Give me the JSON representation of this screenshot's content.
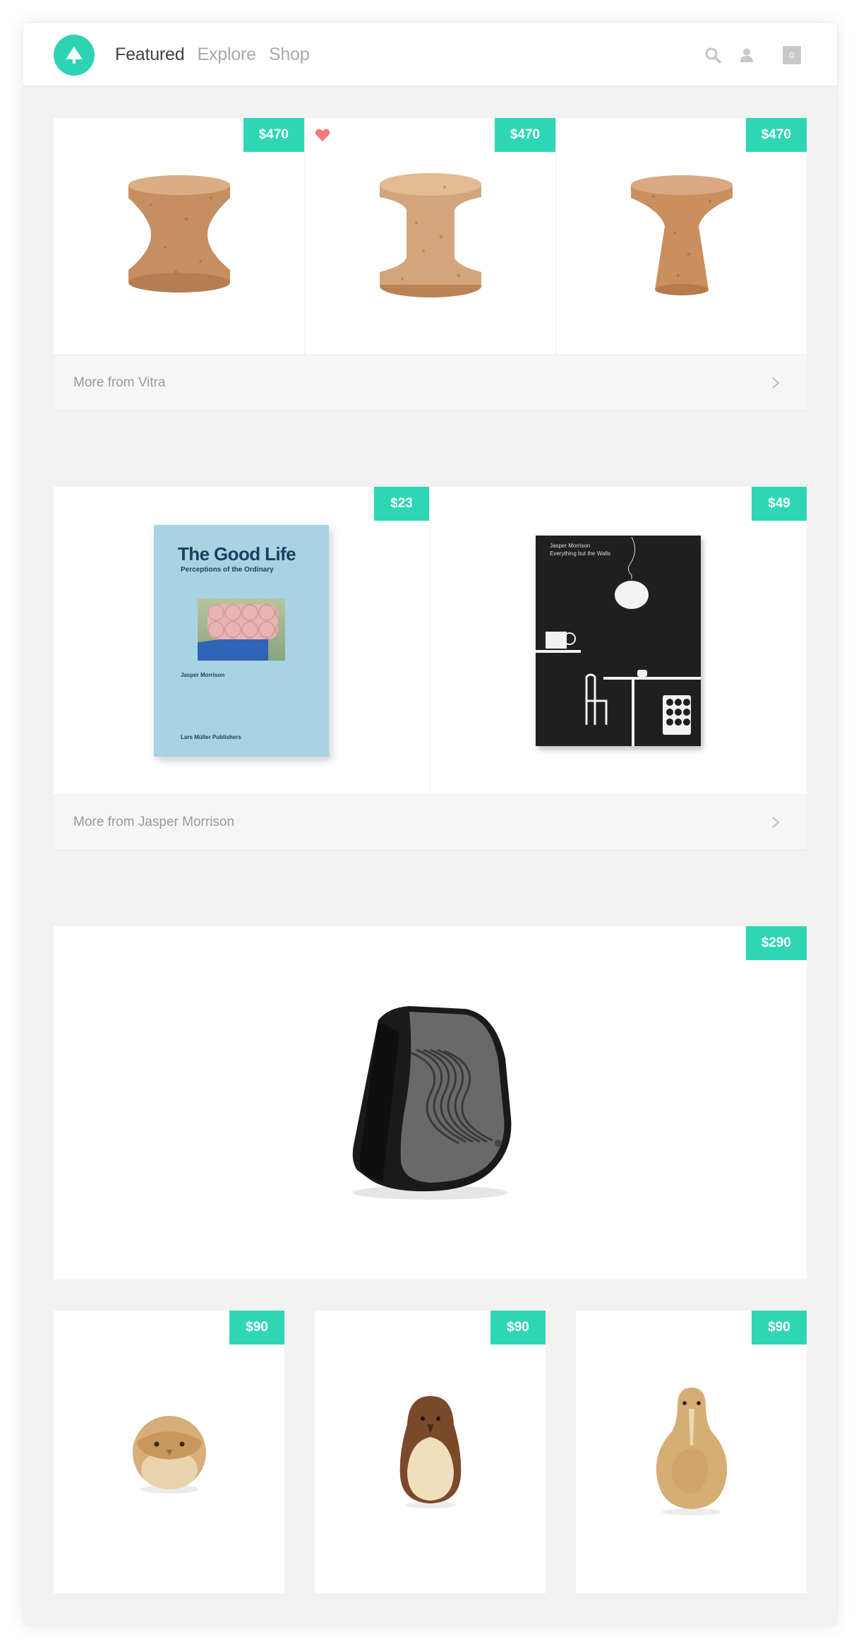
{
  "nav": {
    "items": [
      "Featured",
      "Explore",
      "Shop"
    ],
    "active": "Featured",
    "cart_count": "0"
  },
  "colors": {
    "accent": "#2fd6b5",
    "heart": "#ef7b7e",
    "background": "#f2f2f2"
  },
  "icons": [
    "tree-icon",
    "search-icon",
    "user-icon",
    "heart-icon",
    "chevron-right-icon"
  ],
  "sections": {
    "vitra": {
      "products": [
        {
          "name": "cork-stool-hourglass",
          "price": "$470",
          "liked": false
        },
        {
          "name": "cork-stool-spool",
          "price": "$470",
          "liked": true
        },
        {
          "name": "cork-stool-cone",
          "price": "$470",
          "liked": false
        }
      ],
      "footer": "More from Vitra"
    },
    "morrison": {
      "products": [
        {
          "name": "book-the-good-life",
          "price": "$23"
        },
        {
          "name": "book-everything-but-the-walls",
          "price": "$49"
        }
      ],
      "book1": {
        "title": "The Good Life",
        "subtitle": "Perceptions of the Ordinary",
        "author": "Jasper Morrison",
        "publisher": "Lars Müller Publishers"
      },
      "book2": {
        "author": "Jasper Morrison",
        "title": "Everything but the Walls"
      },
      "footer": "More from Jasper Morrison"
    },
    "speaker": {
      "price": "$290"
    },
    "birds": [
      {
        "name": "wooden-owl",
        "price": "$90"
      },
      {
        "name": "wooden-penguin",
        "price": "$90"
      },
      {
        "name": "wooden-kiwi",
        "price": "$90"
      }
    ]
  }
}
